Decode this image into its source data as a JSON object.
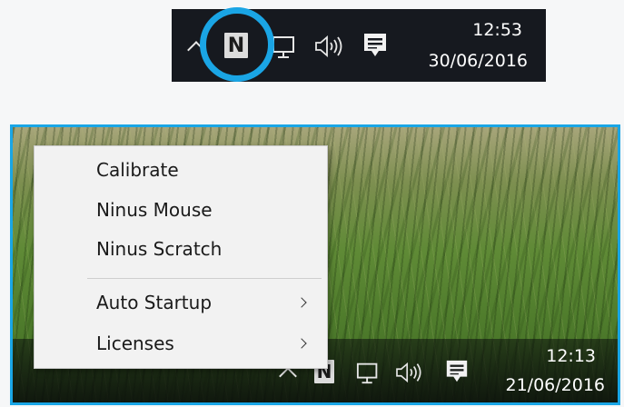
{
  "top_taskbar": {
    "time": "12:53",
    "date": "30/06/2016",
    "app_icon_letter": "N",
    "icons": [
      "show-hidden-icons-chevron-icon",
      "ninus-app-icon",
      "network-icon",
      "volume-icon",
      "action-center-icon"
    ]
  },
  "bottom_taskbar": {
    "time": "12:13",
    "date": "21/06/2016",
    "app_icon_letter": "N",
    "icons": [
      "show-hidden-icons-chevron-icon",
      "ninus-app-icon",
      "network-icon",
      "volume-icon",
      "action-center-icon"
    ]
  },
  "context_menu": {
    "items": [
      {
        "label": "Calibrate",
        "submenu": false
      },
      {
        "label": "Ninus Mouse",
        "submenu": false
      },
      {
        "label": "Ninus Scratch",
        "submenu": false
      },
      {
        "label": "Auto Startup",
        "submenu": true
      },
      {
        "label": "Licenses",
        "submenu": true
      }
    ]
  },
  "colors": {
    "highlight": "#1aa5e5",
    "taskbar": "#16191f",
    "menu_bg": "#f2f2f2"
  }
}
